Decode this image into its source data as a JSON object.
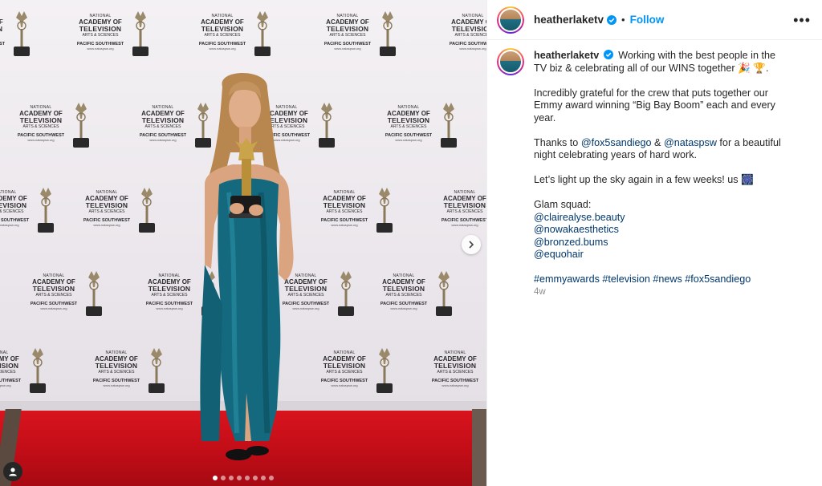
{
  "post": {
    "username": "heatherlaketv",
    "separator": "•",
    "follow_label": "Follow",
    "more_label": "•••",
    "verified_icon": "verified-badge-icon",
    "accent_color": "#0095f6",
    "caption": {
      "line1_text": "Working with the best people in the TV biz & celebrating all of our WINS together 🎉 🏆.",
      "para2": "Incredibly grateful for the crew that puts together our Emmy award winning “Big Bay Boom” each and every year.",
      "para3_pre": "Thanks to ",
      "mention1": "@fox5sandiego",
      "para3_mid": " & ",
      "mention2": "@nataspsw",
      "para3_post": " for a beautiful night celebrating years of hard work.",
      "para4": "Let’s light up the sky again in a few weeks! us 🎆",
      "glam_label": "Glam squad:",
      "glam_mentions": [
        "@clairealyse.beauty",
        "@nowakaesthetics",
        "@bronzed.bums",
        "@equohair"
      ],
      "hashtags": "#emmyawards #television #news #fox5sandiego",
      "timestamp": "4w"
    }
  },
  "media": {
    "next_icon": "chevron-right-icon",
    "tag_icon": "user-tag-icon",
    "carousel_count": 8,
    "carousel_active": 0,
    "logo": {
      "line1": "NATIONAL",
      "line2": "ACADEMY OF",
      "line3": "TELEVISION",
      "line4": "ARTS & SCIENCES",
      "line5": "PACIFIC SOUTHWEST",
      "line6": "www.nataspsw.org"
    }
  }
}
